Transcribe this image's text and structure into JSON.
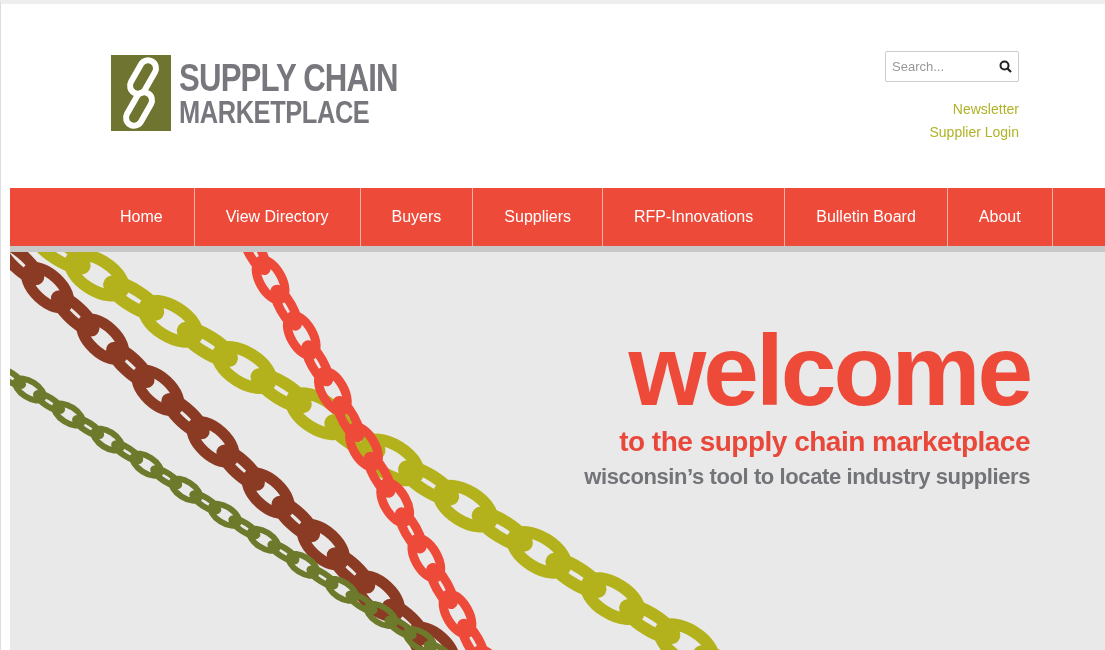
{
  "logo": {
    "line_1": "SUPPLY CHAIN",
    "line_2": "MARKETPLACE"
  },
  "search": {
    "placeholder": "Search..."
  },
  "header_links": [
    "Newsletter",
    "Supplier Login"
  ],
  "nav": [
    "Home",
    "View Directory",
    "Buyers",
    "Suppliers",
    "RFP-Innovations",
    "Bulletin Board",
    "About"
  ],
  "hero": {
    "heading": "welcome",
    "subheading": "to the supply chain marketplace",
    "tagline": "wisconsin’s tool to locate industry suppliers"
  }
}
